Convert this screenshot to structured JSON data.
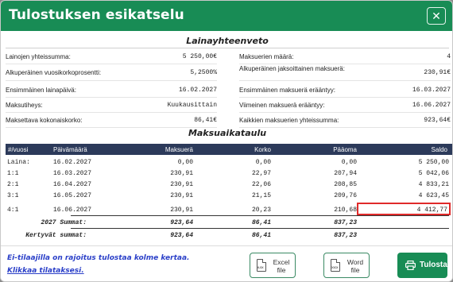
{
  "header": {
    "title": "Tulostuksen esikatselu",
    "close_glyph": "✕"
  },
  "summary": {
    "title": "Lainayhteenveto",
    "left": [
      {
        "label": "Lainojen yhteissumma:",
        "value": "5 250,00€"
      },
      {
        "label": "Alkuperäinen vuosikorkoprosentti:",
        "value": "5,2500%"
      },
      {
        "label": "Ensimmäinen lainapäivä:",
        "value": "16.02.2027"
      },
      {
        "label": "Maksutiheys:",
        "value": "Kuukausittain"
      },
      {
        "label": "Maksettava kokonaiskorko:",
        "value": "86,41€"
      }
    ],
    "right": [
      {
        "label": "Maksuerien määrä:",
        "value": "4"
      },
      {
        "label": "Alkuperäinen jaksoittainen maksuerä:",
        "value": "230,91€"
      },
      {
        "label": "Ensimmäinen maksuerä erääntyy:",
        "value": "16.03.2027"
      },
      {
        "label": "Viimeinen maksuerä erääntyy:",
        "value": "16.06.2027"
      },
      {
        "label": "Kaikkien maksuerien yhteissumma:",
        "value": "923,64€"
      }
    ]
  },
  "schedule": {
    "title": "Maksuaikataulu",
    "columns": [
      "#/vuosi",
      "Päivämäärä",
      "Maksuerä",
      "Korko",
      "Pääoma",
      "Saldo"
    ],
    "rows": [
      [
        "Laina:",
        "16.02.2027",
        "0,00",
        "0,00",
        "0,00",
        "5 250,00"
      ],
      [
        "1:1",
        "16.03.2027",
        "230,91",
        "22,97",
        "207,94",
        "5 042,06"
      ],
      [
        "2:1",
        "16.04.2027",
        "230,91",
        "22,06",
        "208,85",
        "4 833,21"
      ],
      [
        "3:1",
        "16.05.2027",
        "230,91",
        "21,15",
        "209,76",
        "4 623,45"
      ],
      [
        "4:1",
        "16.06.2027",
        "230,91",
        "20,23",
        "210,68",
        "4 412,77"
      ]
    ],
    "totals": [
      {
        "label": "2027 Summat:",
        "payment": "923,64",
        "interest": "86,41",
        "principal": "837,23"
      },
      {
        "label": "Kertyvät summat:",
        "payment": "923,64",
        "interest": "86,41",
        "principal": "837,23"
      }
    ]
  },
  "footer": {
    "note": "Ei-tilaajilla on rajoitus tulostaa kolme kertaa.",
    "subscribe_link": "Klikkaa tilataksesi.",
    "excel": {
      "line1": "Excel",
      "line2": "file",
      "icon_text": "XLSX"
    },
    "word": {
      "line1": "Word",
      "line2": "file",
      "icon_text": "DOCX"
    },
    "print_label": "Tulosta"
  },
  "colors": {
    "header": "#188c55",
    "table_header": "#2c3a5a",
    "link": "#2a3fc8",
    "highlight": "#e02a2a"
  }
}
